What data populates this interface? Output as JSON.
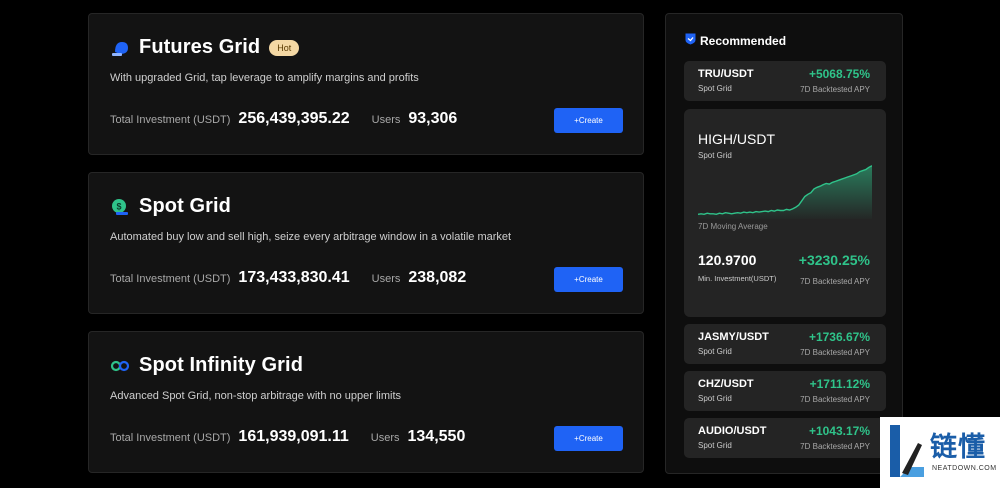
{
  "cards": [
    {
      "title": "Futures Grid",
      "badge": "Hot",
      "description": "With upgraded Grid, tap leverage to amplify margins and profits",
      "investment_label": "Total Investment (USDT)",
      "investment_value": "256,439,395.22",
      "users_label": "Users",
      "users_value": "93,306",
      "button_label": "+Create",
      "icon": "futures-grid-icon"
    },
    {
      "title": "Spot Grid",
      "description": "Automated buy low and sell high, seize every arbitrage window in a volatile market",
      "investment_label": "Total Investment (USDT)",
      "investment_value": "173,433,830.41",
      "users_label": "Users",
      "users_value": "238,082",
      "button_label": "+Create",
      "icon": "spot-grid-icon"
    },
    {
      "title": "Spot Infinity Grid",
      "description": "Advanced Spot Grid, non-stop arbitrage with no upper limits",
      "investment_label": "Total Investment (USDT)",
      "investment_value": "161,939,091.11",
      "users_label": "Users",
      "users_value": "134,550",
      "button_label": "+Create",
      "icon": "infinity-grid-icon"
    }
  ],
  "recommended": {
    "title": "Recommended",
    "icon": "shield-icon",
    "items": [
      {
        "pair": "TRU/USDT",
        "type": "Spot Grid",
        "apy": "+5068.75%",
        "apy_label": "7D Backtested APY"
      },
      {
        "pair": "JASMY/USDT",
        "type": "Spot Grid",
        "apy": "+1736.67%",
        "apy_label": "7D Backtested APY"
      },
      {
        "pair": "CHZ/USDT",
        "type": "Spot Grid",
        "apy": "+1711.12%",
        "apy_label": "7D Backtested APY"
      },
      {
        "pair": "AUDIO/USDT",
        "type": "Spot Grid",
        "apy": "+1043.17%",
        "apy_label": "7D Backtested APY"
      }
    ],
    "featured": {
      "pair": "HIGH/USDT",
      "type": "Spot Grid",
      "chart_label": "7D Moving Average",
      "min_investment": "120.9700",
      "min_investment_label": "Min. Investment(USDT)",
      "apy": "+3230.25%",
      "apy_label": "7D Backtested APY",
      "sparkline": [
        0.05,
        0.06,
        0.05,
        0.07,
        0.06,
        0.06,
        0.05,
        0.07,
        0.06,
        0.08,
        0.07,
        0.06,
        0.07,
        0.08,
        0.07,
        0.09,
        0.08,
        0.09,
        0.08,
        0.1,
        0.09,
        0.1,
        0.11,
        0.1,
        0.12,
        0.11,
        0.13,
        0.12,
        0.12,
        0.14,
        0.13,
        0.15,
        0.18,
        0.22,
        0.3,
        0.38,
        0.42,
        0.45,
        0.52,
        0.55,
        0.57,
        0.6,
        0.62,
        0.61,
        0.64,
        0.66,
        0.68,
        0.7,
        0.72,
        0.74,
        0.76,
        0.78,
        0.8,
        0.84,
        0.86,
        0.88,
        0.92,
        0.95
      ]
    }
  },
  "colors": {
    "accent": "#1f63f5",
    "positive": "#2fc38a",
    "hot_badge": "#f4d8a4"
  },
  "watermark": {
    "text": "链懂",
    "sub": "NEATDOWN.COM"
  }
}
